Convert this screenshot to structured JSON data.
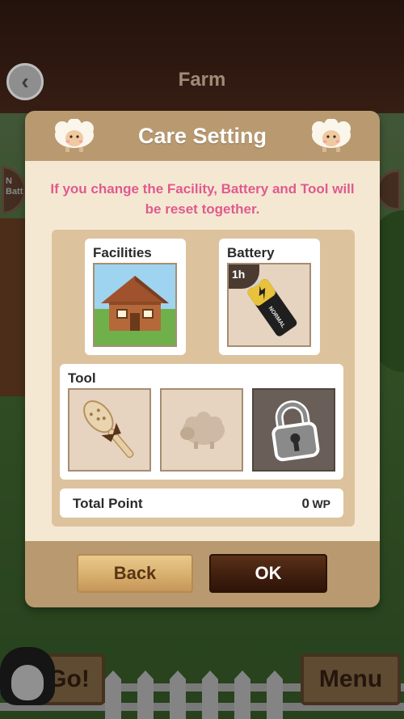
{
  "header": {
    "title": "Farm",
    "back_icon": "chevron-left-icon"
  },
  "background": {
    "left_badge_text": "N Batt",
    "go_sign": "Go!",
    "menu_sign": "Menu"
  },
  "dialog": {
    "title": "Care Setting",
    "notice": "If you change the Facility, Battery and Tool will be reset together.",
    "facilities": {
      "label": "Facilities",
      "image": "wooden-house"
    },
    "battery": {
      "label": "Battery",
      "duration_badge": "1h",
      "battery_text": "NORMAL"
    },
    "tool": {
      "label": "Tool",
      "slots": [
        {
          "icon": "brush-icon",
          "state": "selected"
        },
        {
          "icon": "sheep-icon",
          "state": "empty"
        },
        {
          "icon": "lock-icon",
          "state": "locked"
        }
      ]
    },
    "total": {
      "label": "Total Point",
      "value": "0",
      "unit": "WP"
    },
    "buttons": {
      "back_label": "Back",
      "ok_label": "OK"
    }
  },
  "colors": {
    "notice_pink": "#e05a8e",
    "dialog_frame": "#b99a70",
    "dialog_body": "#f5e8d2",
    "ok_button": "#3e1e0e",
    "back_button": "#d6ad6a"
  }
}
